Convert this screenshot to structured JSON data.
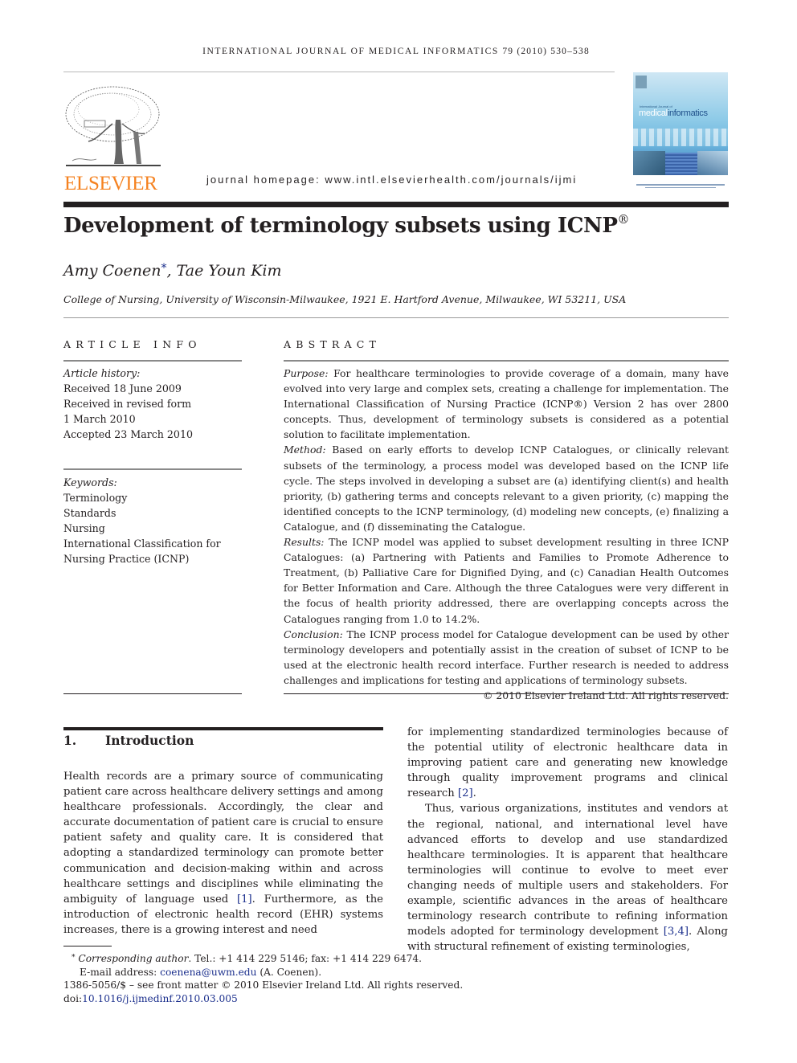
{
  "header": {
    "running_title": "International Journal of Medical Informatics",
    "volume_info": "79 (2010) 530–538",
    "publisher_logo_text": "ELSEVIER",
    "homepage_label": "journal homepage: ",
    "homepage_url": "www.intl.elsevierhealth.com/journals/ijmi",
    "cover": {
      "small_title": "International Journal of",
      "title_part1": "medical",
      "title_part2": "informatics"
    }
  },
  "article": {
    "title": "Development of terminology subsets using ICNP",
    "title_mark": "®",
    "authors": [
      {
        "name": "Amy Coenen",
        "mark": "*"
      },
      {
        "name": "Tae Youn Kim",
        "mark": ""
      }
    ],
    "author_separator": ", ",
    "affiliation": "College of Nursing, University of Wisconsin-Milwaukee, 1921 E. Hartford Avenue, Milwaukee, WI 53211, USA"
  },
  "article_info": {
    "label": "ARTICLE INFO",
    "history_label": "Article history:",
    "history": [
      "Received 18 June 2009",
      "Received in revised form",
      "1 March 2010",
      "Accepted 23 March 2010"
    ],
    "keywords_label": "Keywords:",
    "keywords": [
      "Terminology",
      "Standards",
      "Nursing",
      "International Classification for",
      "Nursing Practice (ICNP)"
    ]
  },
  "abstract": {
    "label": "ABSTRACT",
    "sections": [
      {
        "heading": "Purpose:",
        "text": " For healthcare terminologies to provide coverage of a domain, many have evolved into very large and complex sets, creating a challenge for implementation. The International Classification of Nursing Practice (ICNP®) Version 2 has over 2800 concepts. Thus, development of terminology subsets is considered as a potential solution to facilitate implementation."
      },
      {
        "heading": "Method:",
        "text": " Based on early efforts to develop ICNP Catalogues, or clinically relevant subsets of the terminology, a process model was developed based on the ICNP life cycle. The steps involved in developing a subset are (a) identifying client(s) and health priority, (b) gathering terms and concepts relevant to a given priority, (c) mapping the identified concepts to the ICNP terminology, (d) modeling new concepts, (e) finalizing a Catalogue, and (f) disseminating the Catalogue."
      },
      {
        "heading": "Results:",
        "text": " The ICNP model was applied to subset development resulting in three ICNP Catalogues: (a) Partnering with Patients and Families to Promote Adherence to Treatment, (b) Palliative Care for Dignified Dying, and (c) Canadian Health Outcomes for Better Information and Care. Although the three Catalogues were very different in the focus of health priority addressed, there are overlapping concepts across the Catalogues ranging from 1.0 to 14.2%."
      },
      {
        "heading": "Conclusion:",
        "text": " The ICNP process model for Catalogue development can be used by other terminology developers and potentially assist in the creation of subset of ICNP to be used at the electronic health record interface. Further research is needed to address challenges and implications for testing and applications of terminology subsets."
      }
    ],
    "copyright": "© 2010 Elsevier Ireland Ltd. All rights reserved."
  },
  "introduction": {
    "number": "1.",
    "heading": "Introduction",
    "col1_text_a": "Health records are a primary source of communicating patient care across healthcare delivery settings and among healthcare professionals. Accordingly, the clear and accurate documentation of patient care is crucial to ensure patient safety and quality care. It is considered that adopting a standardized terminology can promote better communication and decision-making within and across healthcare settings and disciplines while eliminating the ambiguity of language used ",
    "ref1": "[1]",
    "col1_text_b": ". Furthermore, as the introduction of electronic health record (EHR) systems increases, there is a growing interest and need",
    "col2_p1_a": "for implementing standardized terminologies because of the potential utility of electronic healthcare data in improving patient care and generating new knowledge through quality improvement programs and clinical research ",
    "ref2": "[2]",
    "col2_p1_b": ".",
    "col2_p2_a": "Thus, various organizations, institutes and vendors at the regional, national, and international level have advanced efforts to develop and use standardized healthcare terminologies. It is apparent that healthcare terminologies will continue to evolve to meet ever changing needs of multiple users and stakeholders. For example, scientific advances in the areas of healthcare terminology research contribute to refining information models adopted for terminology development ",
    "ref34": "[3,4]",
    "col2_p2_b": ". Along with structural refinement of existing terminologies,"
  },
  "footnotes": {
    "mark": "*",
    "corresponding_label": "Corresponding author",
    "contact": ". Tel.: +1 414 229 5146; fax: +1 414 229 6474.",
    "email_label": "E-mail address: ",
    "email": "coenena@uwm.edu",
    "email_owner": " (A. Coenen).",
    "front_matter": "1386-5056/$ – see front matter © 2010 Elsevier Ireland Ltd. All rights reserved.",
    "doi_label": "doi:",
    "doi": "10.1016/j.ijmedinf.2010.03.005"
  }
}
